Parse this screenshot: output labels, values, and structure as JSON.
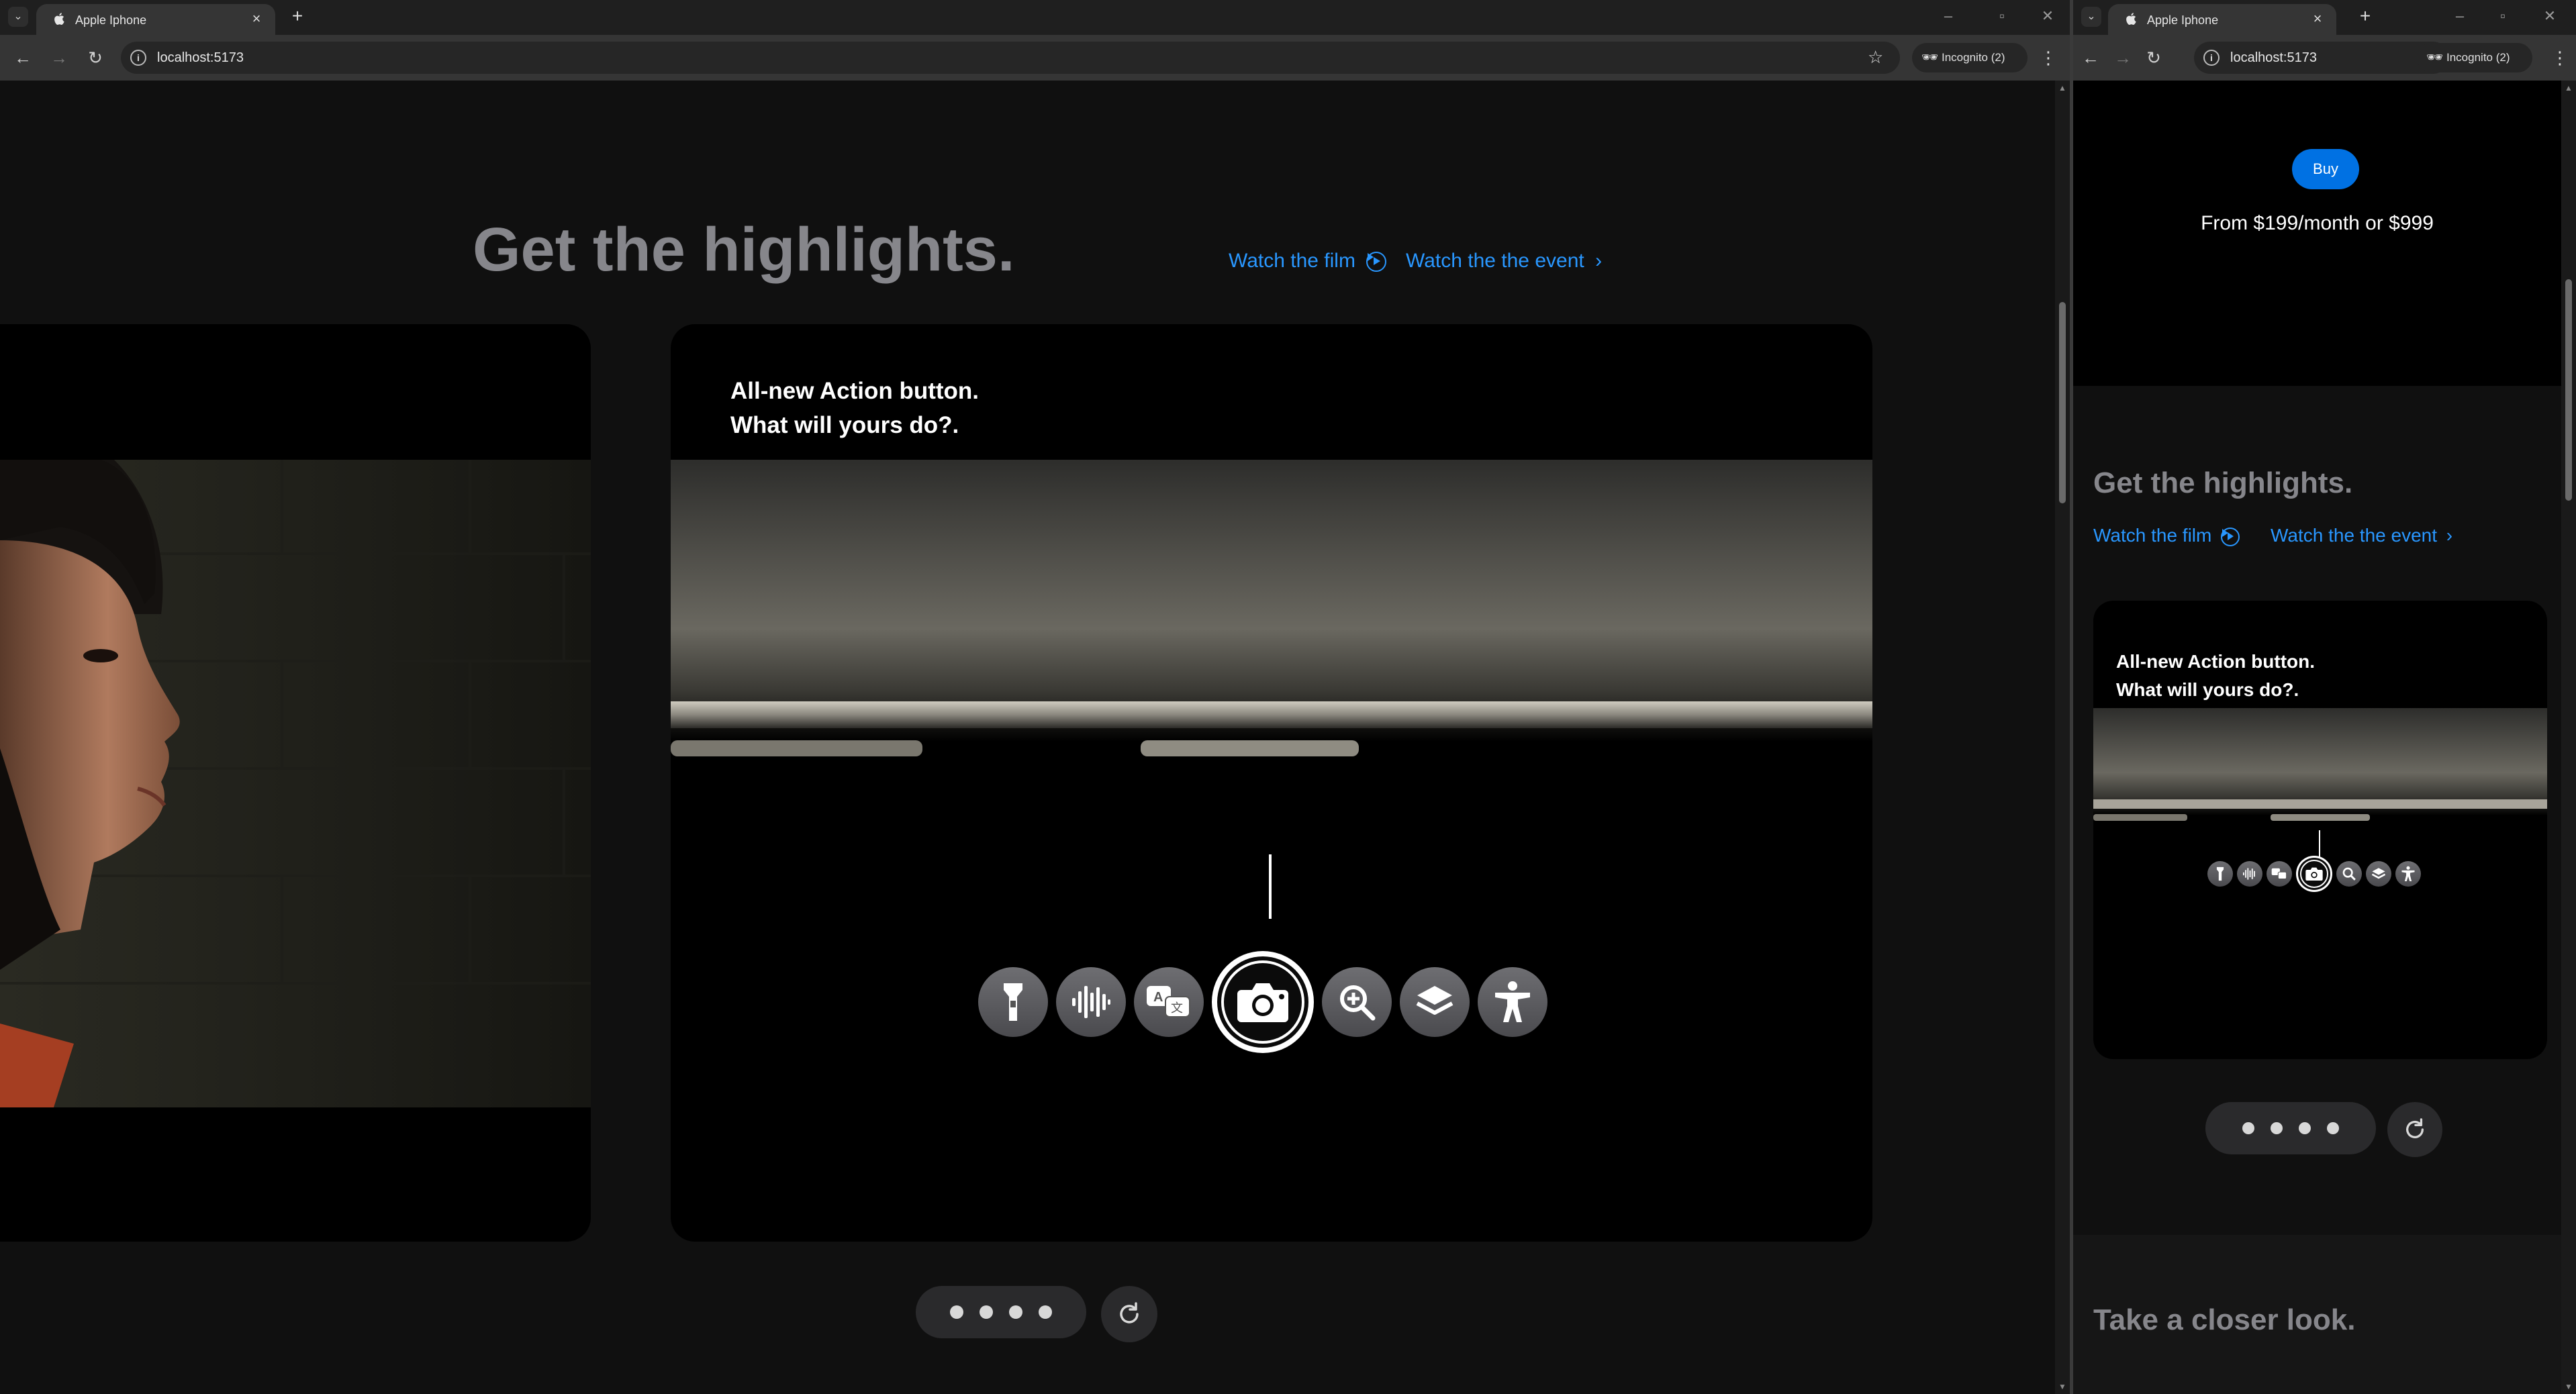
{
  "browser_left": {
    "tab_title": "Apple Iphone",
    "url": "localhost:5173",
    "incognito_label": "Incognito (2)"
  },
  "browser_right": {
    "tab_title": "Apple Iphone",
    "url": "localhost:5173",
    "incognito_label": "Incognito (2)"
  },
  "hero": {
    "buy_label": "Buy",
    "price_text": "From $199/month or $999"
  },
  "highlights": {
    "title": "Get the highlights.",
    "watch_film": "Watch the film",
    "watch_event": "Watch the the event",
    "card_line1": "All-new Action button.",
    "card_line2": "What will yours do?.",
    "action_icons": [
      "flashlight-icon",
      "voice-memo-icon",
      "translate-icon",
      "camera-icon",
      "magnifier-icon",
      "focus-layers-icon",
      "accessibility-icon"
    ],
    "active_icon": "camera-icon"
  },
  "carousel": {
    "dots_count": 4
  },
  "next_section": {
    "title": "Take a closer look."
  },
  "colors": {
    "link": "#2997ff",
    "background": "#101010",
    "card": "#000000",
    "heading": "#86868b",
    "buy_button": "#0071e3"
  }
}
